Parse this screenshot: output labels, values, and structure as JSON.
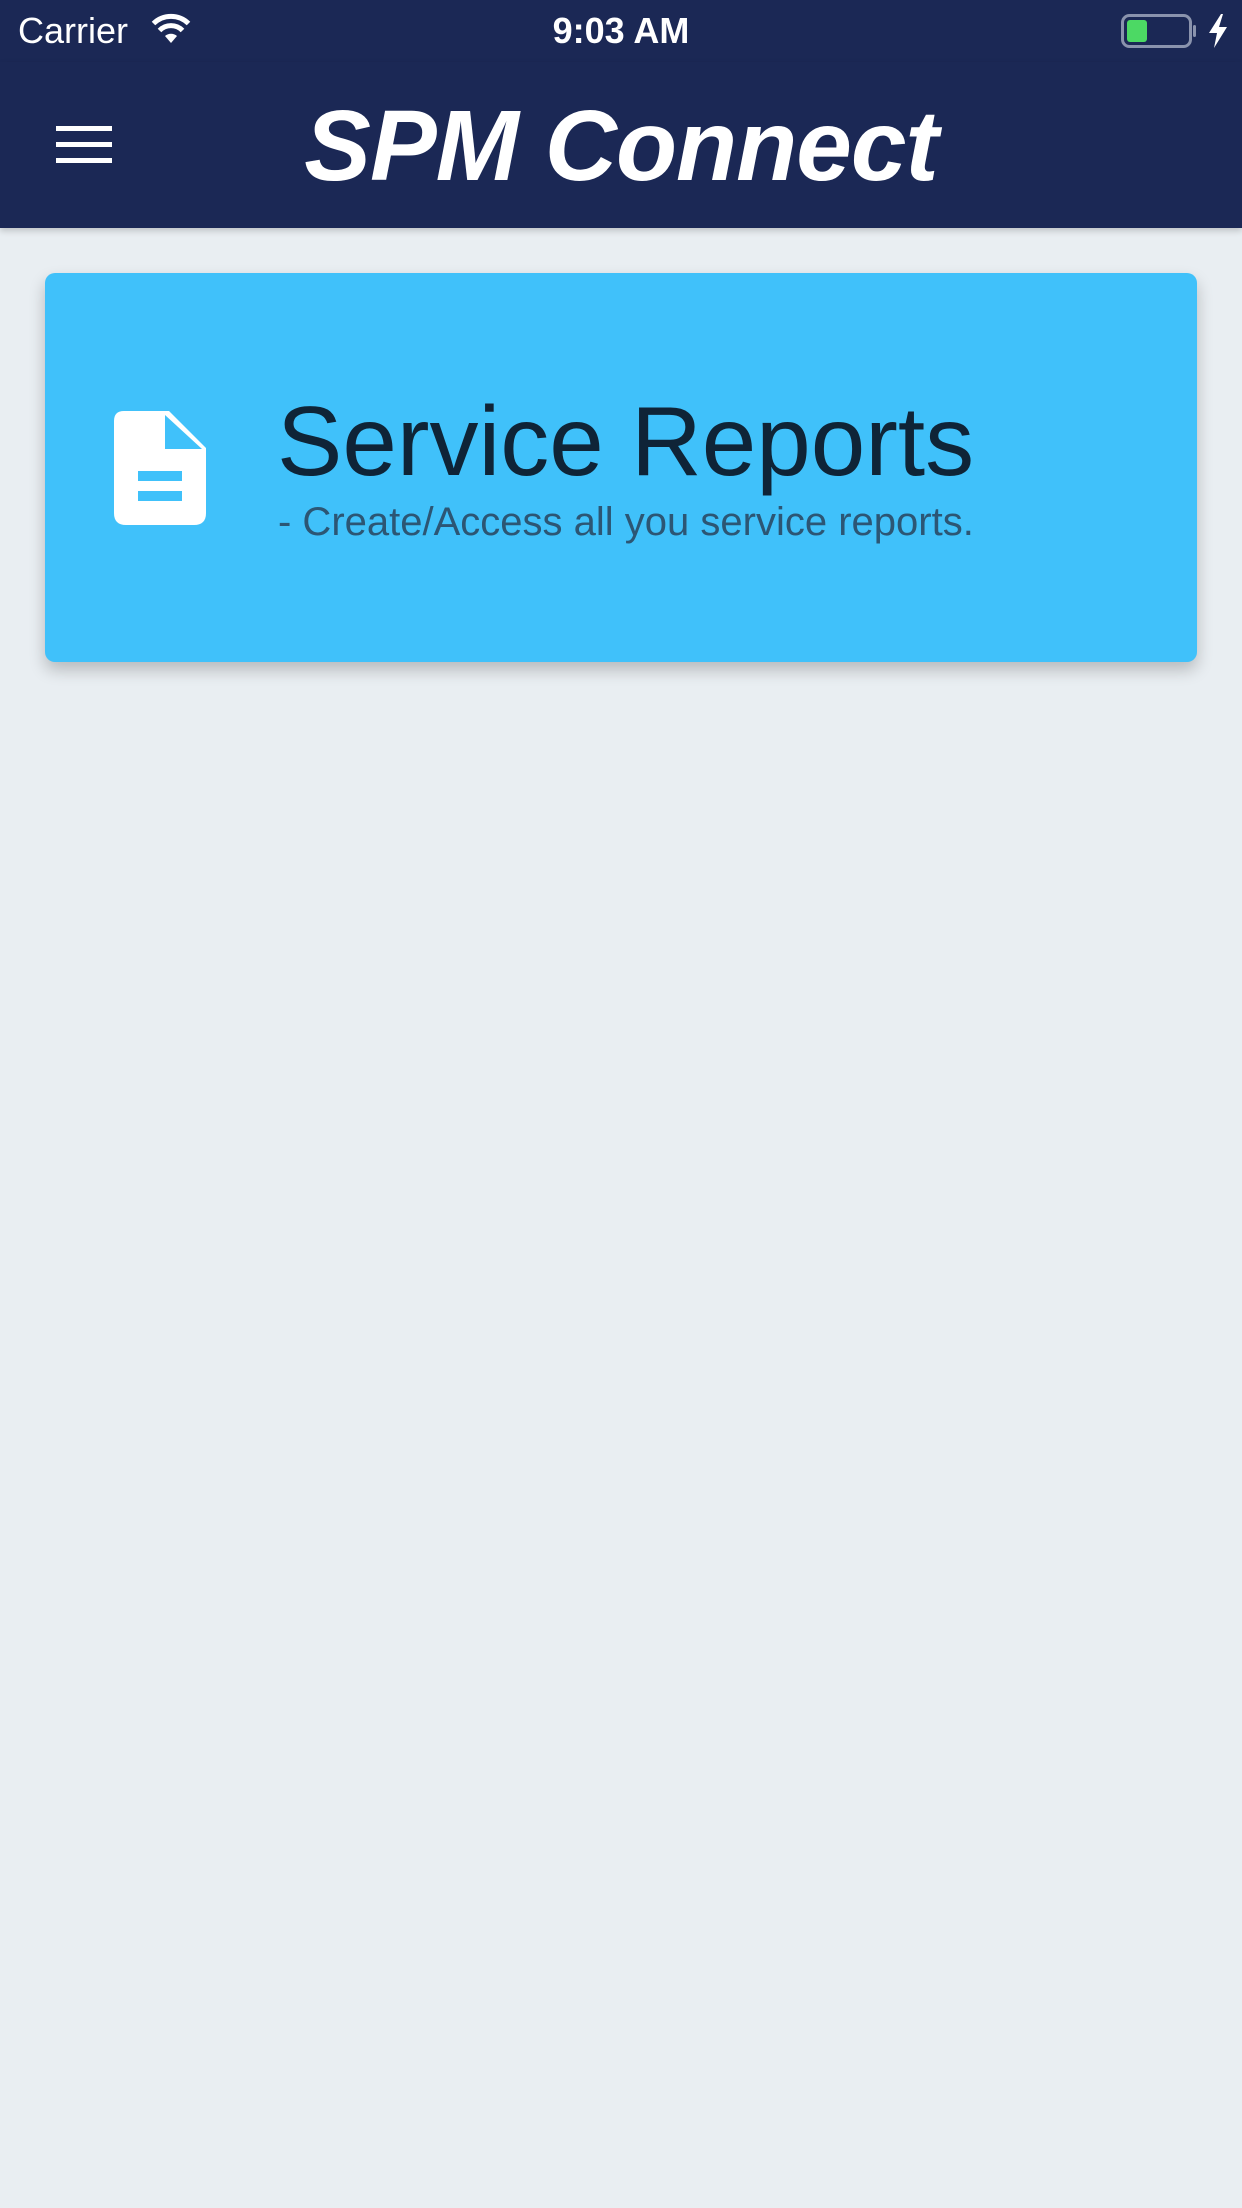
{
  "status_bar": {
    "carrier": "Carrier",
    "time": "9:03 AM",
    "wifi_icon": "wifi-icon",
    "battery_icon": "battery-charging-icon",
    "battery_color": "#4cd964"
  },
  "nav_bar": {
    "title": "SPM Connect",
    "menu_icon": "hamburger-menu-icon",
    "background": "#1b2855"
  },
  "cards": [
    {
      "icon": "document-icon",
      "title": "Service Reports",
      "subtitle": "- Create/Access all you service reports.",
      "color": "#40c1fa"
    }
  ],
  "theme": {
    "page_background": "#e9eef2",
    "title_text": "#0f2437",
    "subtitle_text": "#2c5674"
  }
}
